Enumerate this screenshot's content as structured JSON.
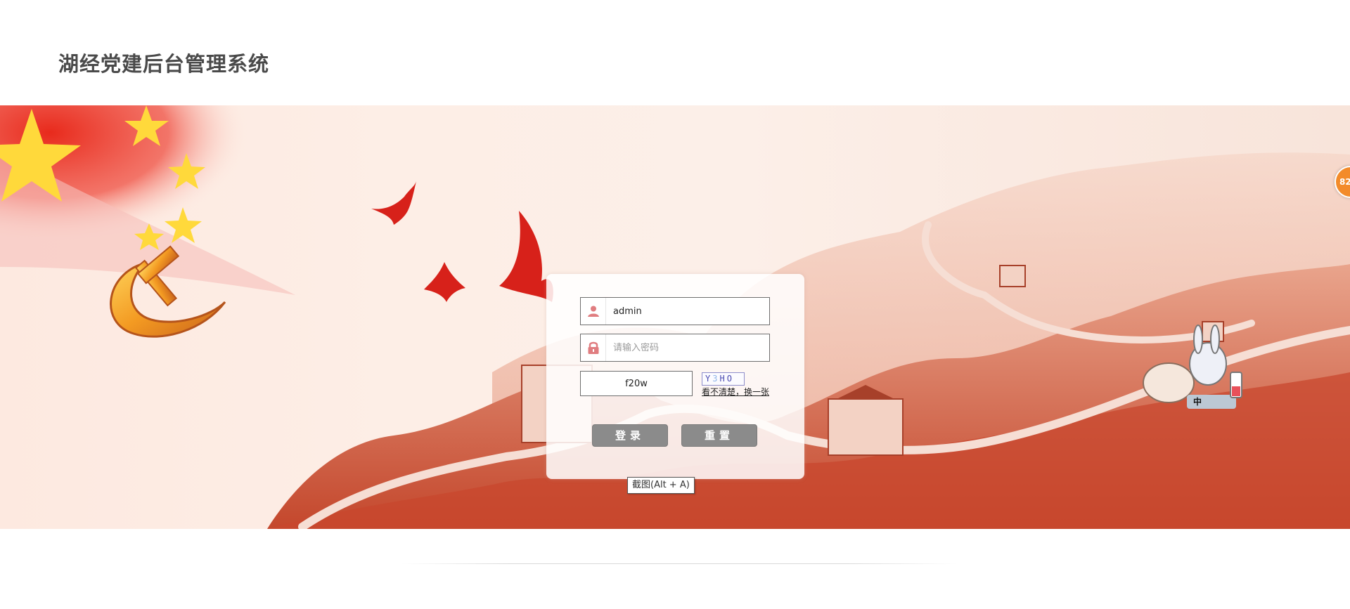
{
  "header": {
    "title": "湖经党建后台管理系统"
  },
  "login": {
    "username_value": "admin",
    "password_placeholder": "请输入密码",
    "captcha_value": "f20w",
    "captcha_image_text": {
      "c1": "Y",
      "c2": "3",
      "c3": "H",
      "c4": "O"
    },
    "captcha_refresh": "看不清楚，换一张",
    "login_label": "登录",
    "reset_label": "重置"
  },
  "tooltip": {
    "text": "截图(Alt + A)"
  },
  "side_badge": {
    "text": "82"
  },
  "widget": {
    "ime_text": "中"
  },
  "colors": {
    "accent": "#d8291b",
    "button": "#8b8b8b",
    "badge": "#f38b2a"
  }
}
